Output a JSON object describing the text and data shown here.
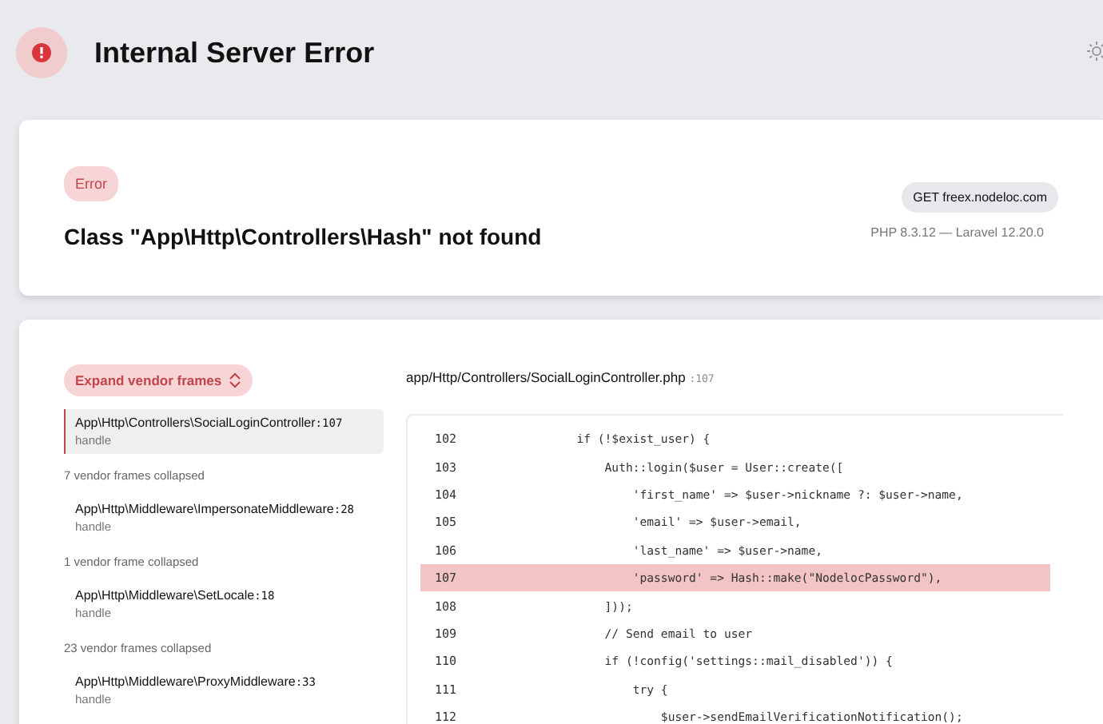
{
  "header": {
    "title": "Internal Server Error"
  },
  "error": {
    "badge": "Error",
    "message": "Class \"App\\Http\\Controllers\\Hash\" not found",
    "request": "GET freex.nodeloc.com",
    "versions": "PHP 8.3.12 — Laravel 12.20.0"
  },
  "trace": {
    "expand_button": "Expand vendor frames",
    "frames": [
      {
        "kind": "frame",
        "class": "App\\Http\\Controllers\\SocialLoginController",
        "line": ":107",
        "method": "handle",
        "selected": true
      },
      {
        "kind": "collapsed",
        "text": "7 vendor frames collapsed"
      },
      {
        "kind": "frame",
        "class": "App\\Http\\Middleware\\ImpersonateMiddleware",
        "line": ":28",
        "method": "handle",
        "selected": false
      },
      {
        "kind": "collapsed",
        "text": "1 vendor frame collapsed"
      },
      {
        "kind": "frame",
        "class": "App\\Http\\Middleware\\SetLocale",
        "line": ":18",
        "method": "handle",
        "selected": false
      },
      {
        "kind": "collapsed",
        "text": "23 vendor frames collapsed"
      },
      {
        "kind": "frame",
        "class": "App\\Http\\Middleware\\ProxyMiddleware",
        "line": ":33",
        "method": "handle",
        "selected": false
      }
    ]
  },
  "source": {
    "file": "app/Http/Controllers/SocialLoginController.php",
    "line": ":107",
    "lines": [
      {
        "number": "102",
        "code": "            if (!$exist_user) {",
        "highlighted": false
      },
      {
        "number": "103",
        "code": "                Auth::login($user = User::create([",
        "highlighted": false
      },
      {
        "number": "104",
        "code": "                    'first_name' => $user->nickname ?: $user->name,",
        "highlighted": false
      },
      {
        "number": "105",
        "code": "                    'email' => $user->email,",
        "highlighted": false
      },
      {
        "number": "106",
        "code": "                    'last_name' => $user->name,",
        "highlighted": false
      },
      {
        "number": "107",
        "code": "                    'password' => Hash::make(\"NodelocPassword\"),",
        "highlighted": true
      },
      {
        "number": "108",
        "code": "                ]));",
        "highlighted": false
      },
      {
        "number": "109",
        "code": "                // Send email to user",
        "highlighted": false
      },
      {
        "number": "110",
        "code": "                if (!config('settings::mail_disabled')) {",
        "highlighted": false
      },
      {
        "number": "111",
        "code": "                    try {",
        "highlighted": false
      },
      {
        "number": "112",
        "code": "                        $user->sendEmailVerificationNotification();",
        "highlighted": false
      }
    ]
  }
}
